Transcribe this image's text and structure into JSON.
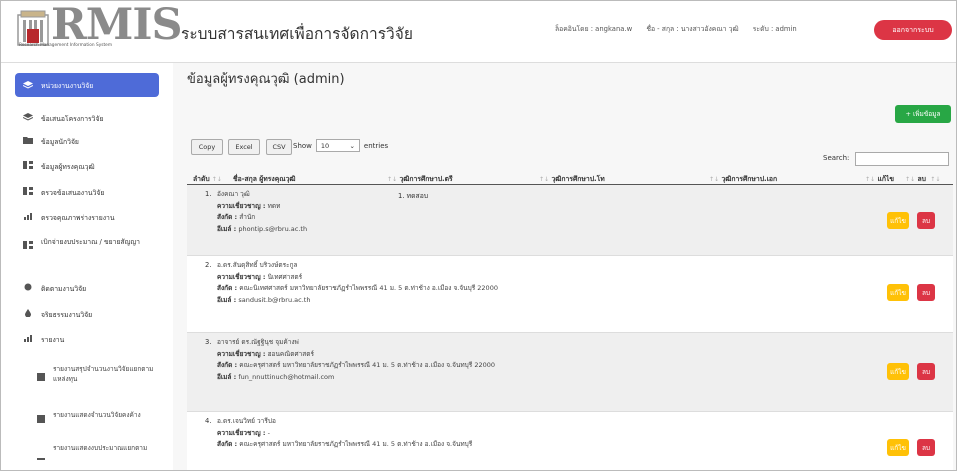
{
  "header": {
    "logo_text": "RMIS",
    "logo_subtitle": "Research Management Information System",
    "app_title": "ระบบสารสนเทศเพื่อการจัดการวิจัย",
    "login_info": "ล็อคอินโดย : angkana.w",
    "name_info": "ชื่อ - สกุล : นางสาวอังคณา วุฒิ",
    "level_info": "ระดับ : admin",
    "logout_label": "ออกจากระบบ"
  },
  "sidebar": {
    "items": [
      {
        "label": "หน่วยงานงานวิจัย"
      },
      {
        "label": "ข้อเสนอโครงการวิจัย"
      },
      {
        "label": "ข้อมูลนักวิจัย"
      },
      {
        "label": "ข้อมูลผู้ทรงคุณวุฒิ"
      },
      {
        "label": "ตรวจข้อเสนองานวิจัย"
      },
      {
        "label": "ตรวจคุณภาพร่างรายงาน"
      },
      {
        "label": "เบิกจ่ายงบประมาณ / ขยายสัญญา"
      },
      {
        "label": "ติดตามงานวิจัย"
      },
      {
        "label": "จริยธรรมงานวิจัย"
      },
      {
        "label": "รายงาน"
      }
    ],
    "report_items": [
      {
        "label": "รายงานสรุปจำนวนงานวิจัยแยกตามแหล่งทุน"
      },
      {
        "label": "รายงานแสดงจำนวนวิจัยคงค้าง"
      },
      {
        "label": "รายงานแสดงงบประมาณแยกตาม"
      }
    ]
  },
  "main": {
    "page_title": "ข้อมูลผู้ทรงคุณวุฒิ (admin)",
    "add_label": "+ เพิ่มข้อมูล",
    "buttons": {
      "copy": "Copy",
      "excel": "Excel",
      "csv": "CSV"
    },
    "show_label": "Show",
    "entries_value": "10",
    "entries_label": "entries",
    "search_label": "Search:",
    "columns": {
      "no": "ลำดับ",
      "name": "ชื่อ-สกุล ผู้ทรงคุณวุฒิ",
      "bachelor": "วุฒิการศึกษาป.ตรี",
      "master": "วุฒิการศึกษาป.โท",
      "doctor": "วุฒิการศึกษาป.เอก",
      "edit": "แก้ไข",
      "delete": "ลบ"
    },
    "labels": {
      "expertise": "ความเชี่ยวชาญ :",
      "affiliation": "สังกัด :",
      "email": "อีเมล์ :"
    },
    "edit_label": "แก้ไข",
    "delete_label": "ลบ",
    "rows": [
      {
        "no": "1.",
        "name": "อังคณา วุฒิ",
        "expertise": "ทดท",
        "affiliation": "สำนัก",
        "email": "phontip.s@rbru.ac.th",
        "bachelor": "1. ทดสอบ"
      },
      {
        "no": "2.",
        "name": "อ.ดร.สันดุสิทธิ์ บริวงษ์ตระกูล",
        "expertise": "นิเทศศาสตร์",
        "affiliation": "คณะนิเทศศาสตร์ มหาวิทยาลัยราชภัฏรำไพพรรณี 41 ม. 5 ต.ท่าช้าง อ.เมือง จ.จันบุรี 22000",
        "email": "sandusit.b@rbru.ac.th",
        "bachelor": ""
      },
      {
        "no": "3.",
        "name": "อาจารย์ ดร.ณัฐฐินุช จุมค้างพ่",
        "expertise": "ฮอนคณิตศาสตร์",
        "affiliation": "คณะครุศาสตร์ มหาวิทยาลัยราชภัฏรำไพพรรณี 41 ม. 5 ต.ท่าช้าง อ.เมือง จ.จันทบุรี 22000",
        "email": "fun_nnuttinuch@hotmail.com",
        "bachelor": ""
      },
      {
        "no": "4.",
        "name": "อ.ดร.เจนวิทย์ วารีบ่อ",
        "expertise": "-",
        "affiliation": "คณะครุศาสตร์ มหาวิทยาลัยราชภัฏรำไพพรรณี 41 ม. 5 ต.ท่าช้าง อ.เมือง จ.จันทบุรี",
        "email": "",
        "bachelor": ""
      }
    ]
  }
}
